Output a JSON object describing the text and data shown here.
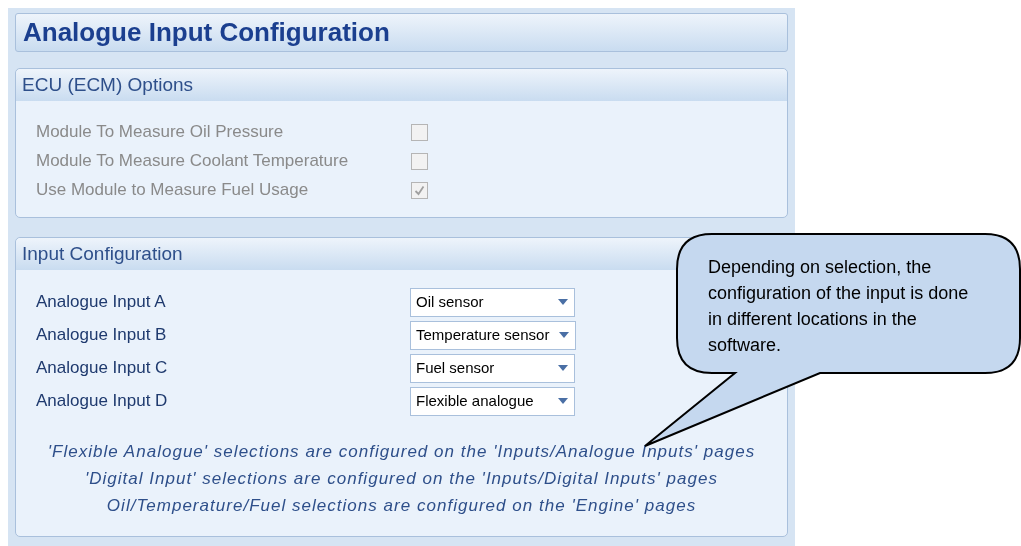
{
  "title": "Analogue Input Configuration",
  "ecu_options": {
    "title": "ECU (ECM) Options",
    "items": [
      {
        "label": "Module To Measure Oil Pressure",
        "checked": false,
        "disabled": true
      },
      {
        "label": "Module To Measure Coolant Temperature",
        "checked": false,
        "disabled": true
      },
      {
        "label": "Use Module to Measure Fuel Usage",
        "checked": true,
        "disabled": true
      }
    ]
  },
  "input_configuration": {
    "title": "Input Configuration",
    "inputs": [
      {
        "label": "Analogue Input A",
        "value": "Oil sensor"
      },
      {
        "label": "Analogue Input B",
        "value": "Temperature sensor"
      },
      {
        "label": "Analogue Input C",
        "value": "Fuel sensor"
      },
      {
        "label": "Analogue Input D",
        "value": "Flexible analogue"
      }
    ],
    "notes": [
      "'Flexible Analogue' selections are configured on the 'Inputs/Analogue Inputs' pages",
      "'Digital Input' selections are configured on the 'Inputs/Digital Inputs' pages",
      "Oil/Temperature/Fuel selections are configured on the 'Engine' pages"
    ]
  },
  "callout": {
    "text": "Depending on selection, the configuration of the input is done in different locations in the software."
  }
}
